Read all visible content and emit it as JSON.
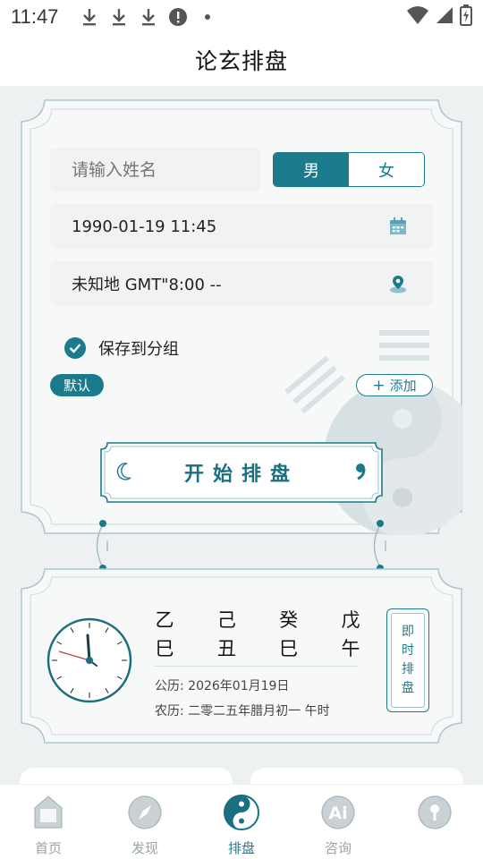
{
  "status_bar": {
    "time": "11:47",
    "left_icons": [
      "download-icon",
      "download-icon",
      "download-icon",
      "alert-icon",
      "dot-icon"
    ],
    "right_icons": [
      "wifi-icon",
      "signal-icon",
      "battery-icon"
    ]
  },
  "header": {
    "title": "论玄排盘"
  },
  "form": {
    "name_placeholder": "请输入姓名",
    "gender": {
      "male": "男",
      "female": "女",
      "selected": "男"
    },
    "datetime": "1990-01-19 11:45",
    "location": "未知地  GMT\"8:00 --",
    "save_label": "保存到分组",
    "save_checked": true,
    "default_tag": "默认",
    "add_label": "添加",
    "start_button": "开始排盘"
  },
  "instant": {
    "pillars_top": [
      "乙",
      "己",
      "癸",
      "戊"
    ],
    "pillars_bottom": [
      "巳",
      "丑",
      "巳",
      "午"
    ],
    "solar": "公历: 2026年01月19日",
    "lunar": "农历: 二零二五年腊月初一 午时",
    "button_chars": [
      "即",
      "时",
      "排",
      "盘"
    ]
  },
  "nav": {
    "items": [
      {
        "label": "首页",
        "icon": "home-icon"
      },
      {
        "label": "发现",
        "icon": "compass-icon"
      },
      {
        "label": "排盘",
        "icon": "yin-yang-icon"
      },
      {
        "label": "咨询",
        "icon": "ai-icon"
      },
      {
        "label": "",
        "icon": "profile-icon"
      }
    ],
    "active": "排盘"
  },
  "colors": {
    "accent": "#1b7a8c",
    "background": "#eef1f2",
    "field": "#f0f2f3"
  }
}
